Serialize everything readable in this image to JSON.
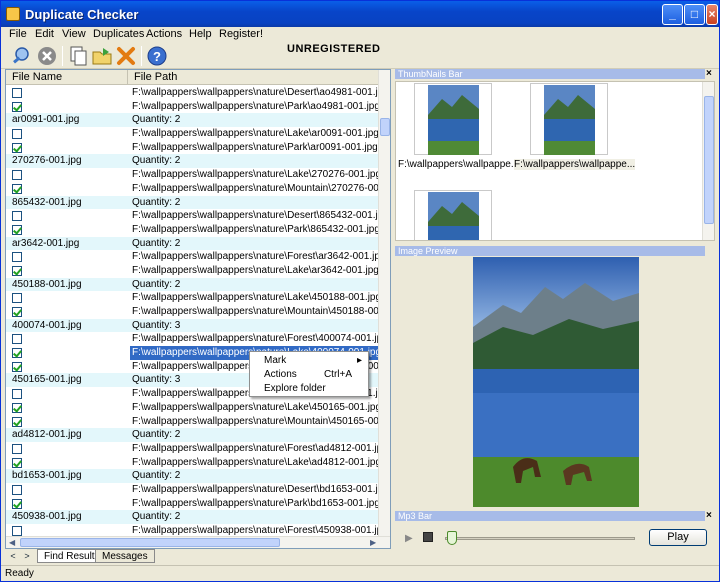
{
  "window": {
    "title": "Duplicate Checker"
  },
  "menu": [
    "File",
    "Edit",
    "View",
    "Duplicates",
    "Actions",
    "Help",
    "Register!"
  ],
  "toolbar": {
    "banner": "UNREGISTERED"
  },
  "columns": {
    "name": "File Name",
    "path": "File Path"
  },
  "rows": [
    {
      "type": "file",
      "checked": false,
      "path": "F:\\wallpappers\\wallpappers\\nature\\Desert\\ao4981-001.jpg"
    },
    {
      "type": "file",
      "checked": true,
      "path": "F:\\wallpappers\\wallpappers\\nature\\Park\\ao4981-001.jpg"
    },
    {
      "type": "group",
      "name": "ar0091-001.jpg",
      "path": "Quantity: 2"
    },
    {
      "type": "file",
      "checked": false,
      "path": "F:\\wallpappers\\wallpappers\\nature\\Lake\\ar0091-001.jpg"
    },
    {
      "type": "file",
      "checked": true,
      "path": "F:\\wallpappers\\wallpappers\\nature\\Park\\ar0091-001.jpg"
    },
    {
      "type": "group",
      "name": "270276-001.jpg",
      "path": "Quantity: 2"
    },
    {
      "type": "file",
      "checked": false,
      "path": "F:\\wallpappers\\wallpappers\\nature\\Lake\\270276-001.jpg"
    },
    {
      "type": "file",
      "checked": true,
      "path": "F:\\wallpappers\\wallpappers\\nature\\Mountain\\270276-001.jpg"
    },
    {
      "type": "group",
      "name": "865432-001.jpg",
      "path": "Quantity: 2"
    },
    {
      "type": "file",
      "checked": false,
      "path": "F:\\wallpappers\\wallpappers\\nature\\Desert\\865432-001.jpg"
    },
    {
      "type": "file",
      "checked": true,
      "path": "F:\\wallpappers\\wallpappers\\nature\\Park\\865432-001.jpg"
    },
    {
      "type": "group",
      "name": "ar3642-001.jpg",
      "path": "Quantity: 2"
    },
    {
      "type": "file",
      "checked": false,
      "path": "F:\\wallpappers\\wallpappers\\nature\\Forest\\ar3642-001.jpg"
    },
    {
      "type": "file",
      "checked": true,
      "path": "F:\\wallpappers\\wallpappers\\nature\\Lake\\ar3642-001.jpg"
    },
    {
      "type": "group",
      "name": "450188-001.jpg",
      "path": "Quantity: 2"
    },
    {
      "type": "file",
      "checked": false,
      "path": "F:\\wallpappers\\wallpappers\\nature\\Lake\\450188-001.jpg"
    },
    {
      "type": "file",
      "checked": true,
      "path": "F:\\wallpappers\\wallpappers\\nature\\Mountain\\450188-001.jpg"
    },
    {
      "type": "group",
      "name": "400074-001.jpg",
      "path": "Quantity: 3"
    },
    {
      "type": "file",
      "checked": false,
      "path": "F:\\wallpappers\\wallpappers\\nature\\Forest\\400074-001.jpg"
    },
    {
      "type": "file",
      "checked": true,
      "selected": true,
      "path": "F:\\wallpappers\\wallpappers\\nature\\Lake\\400074-001.jpg"
    },
    {
      "type": "file",
      "checked": true,
      "path": "F:\\wallpappers\\wallpappers\\nature\\Mountain\\400074-001.jpg"
    },
    {
      "type": "group",
      "name": "450165-001.jpg",
      "path": "Quantity: 3"
    },
    {
      "type": "file",
      "checked": false,
      "path": "F:\\wallpappers\\wallpappers\\nature\\Desert\\450165-001.jpg"
    },
    {
      "type": "file",
      "checked": true,
      "path": "F:\\wallpappers\\wallpappers\\nature\\Lake\\450165-001.jpg"
    },
    {
      "type": "file",
      "checked": true,
      "path": "F:\\wallpappers\\wallpappers\\nature\\Mountain\\450165-001.jpg"
    },
    {
      "type": "group",
      "name": "ad4812-001.jpg",
      "path": "Quantity: 2"
    },
    {
      "type": "file",
      "checked": false,
      "path": "F:\\wallpappers\\wallpappers\\nature\\Forest\\ad4812-001.jpg"
    },
    {
      "type": "file",
      "checked": true,
      "path": "F:\\wallpappers\\wallpappers\\nature\\Lake\\ad4812-001.jpg"
    },
    {
      "type": "group",
      "name": "bd1653-001.jpg",
      "path": "Quantity: 2"
    },
    {
      "type": "file",
      "checked": false,
      "path": "F:\\wallpappers\\wallpappers\\nature\\Desert\\bd1653-001.jpg"
    },
    {
      "type": "file",
      "checked": true,
      "path": "F:\\wallpappers\\wallpappers\\nature\\Park\\bd1653-001.jpg"
    },
    {
      "type": "group",
      "name": "450938-001.jpg",
      "path": "Quantity: 2"
    },
    {
      "type": "file",
      "checked": false,
      "path": "F:\\wallpappers\\wallpappers\\nature\\Forest\\450938-001.jpg"
    }
  ],
  "context_menu": {
    "mark": "Mark",
    "actions": "Actions",
    "actions_shortcut": "Ctrl+A",
    "explore": "Explore folder"
  },
  "tabs": {
    "find": "Find Results",
    "messages": "Messages"
  },
  "thumbnails": {
    "title": "ThumbNails Bar",
    "label1": "F:\\wallpappers\\wallpappe...",
    "label2": "F:\\wallpappers\\wallpappe..."
  },
  "preview": {
    "title": "Image Preview"
  },
  "mp3": {
    "title": "Mp3 Bar",
    "play": "Play"
  },
  "status": {
    "text": "Ready"
  },
  "colors": {
    "title_blue": "#0845c9",
    "selection": "#316ac5",
    "group_row": "#e3f7fb",
    "panel_header": "#a7bbe8"
  }
}
